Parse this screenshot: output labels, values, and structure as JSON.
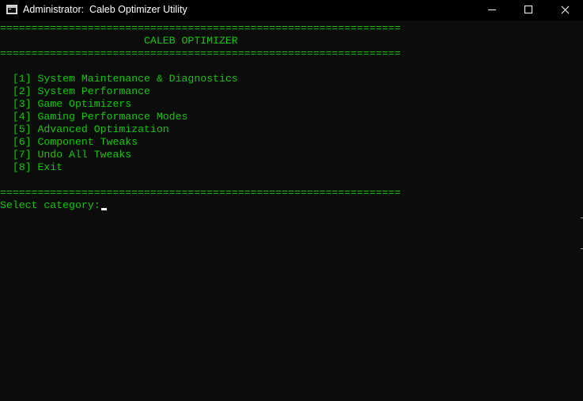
{
  "window": {
    "title": "Administrator:  Caleb Optimizer Utility",
    "controls": [
      "minimize-icon",
      "maximize-icon",
      "close-icon"
    ]
  },
  "console": {
    "separator": "================================================================",
    "header": "                       CALEB OPTIMIZER",
    "menu": [
      "  [1] System Maintenance & Diagnostics",
      "  [2] System Performance",
      "  [3] Game Optimizers",
      "  [4] Gaming Performance Modes",
      "  [5] Advanced Optimization",
      "  [6] Component Tweaks",
      "  [7] Undo All Tweaks",
      "  [8] Exit"
    ],
    "prompt": "Select category:",
    "text_color": "#16c60c",
    "background_color": "#0c0c0c"
  }
}
